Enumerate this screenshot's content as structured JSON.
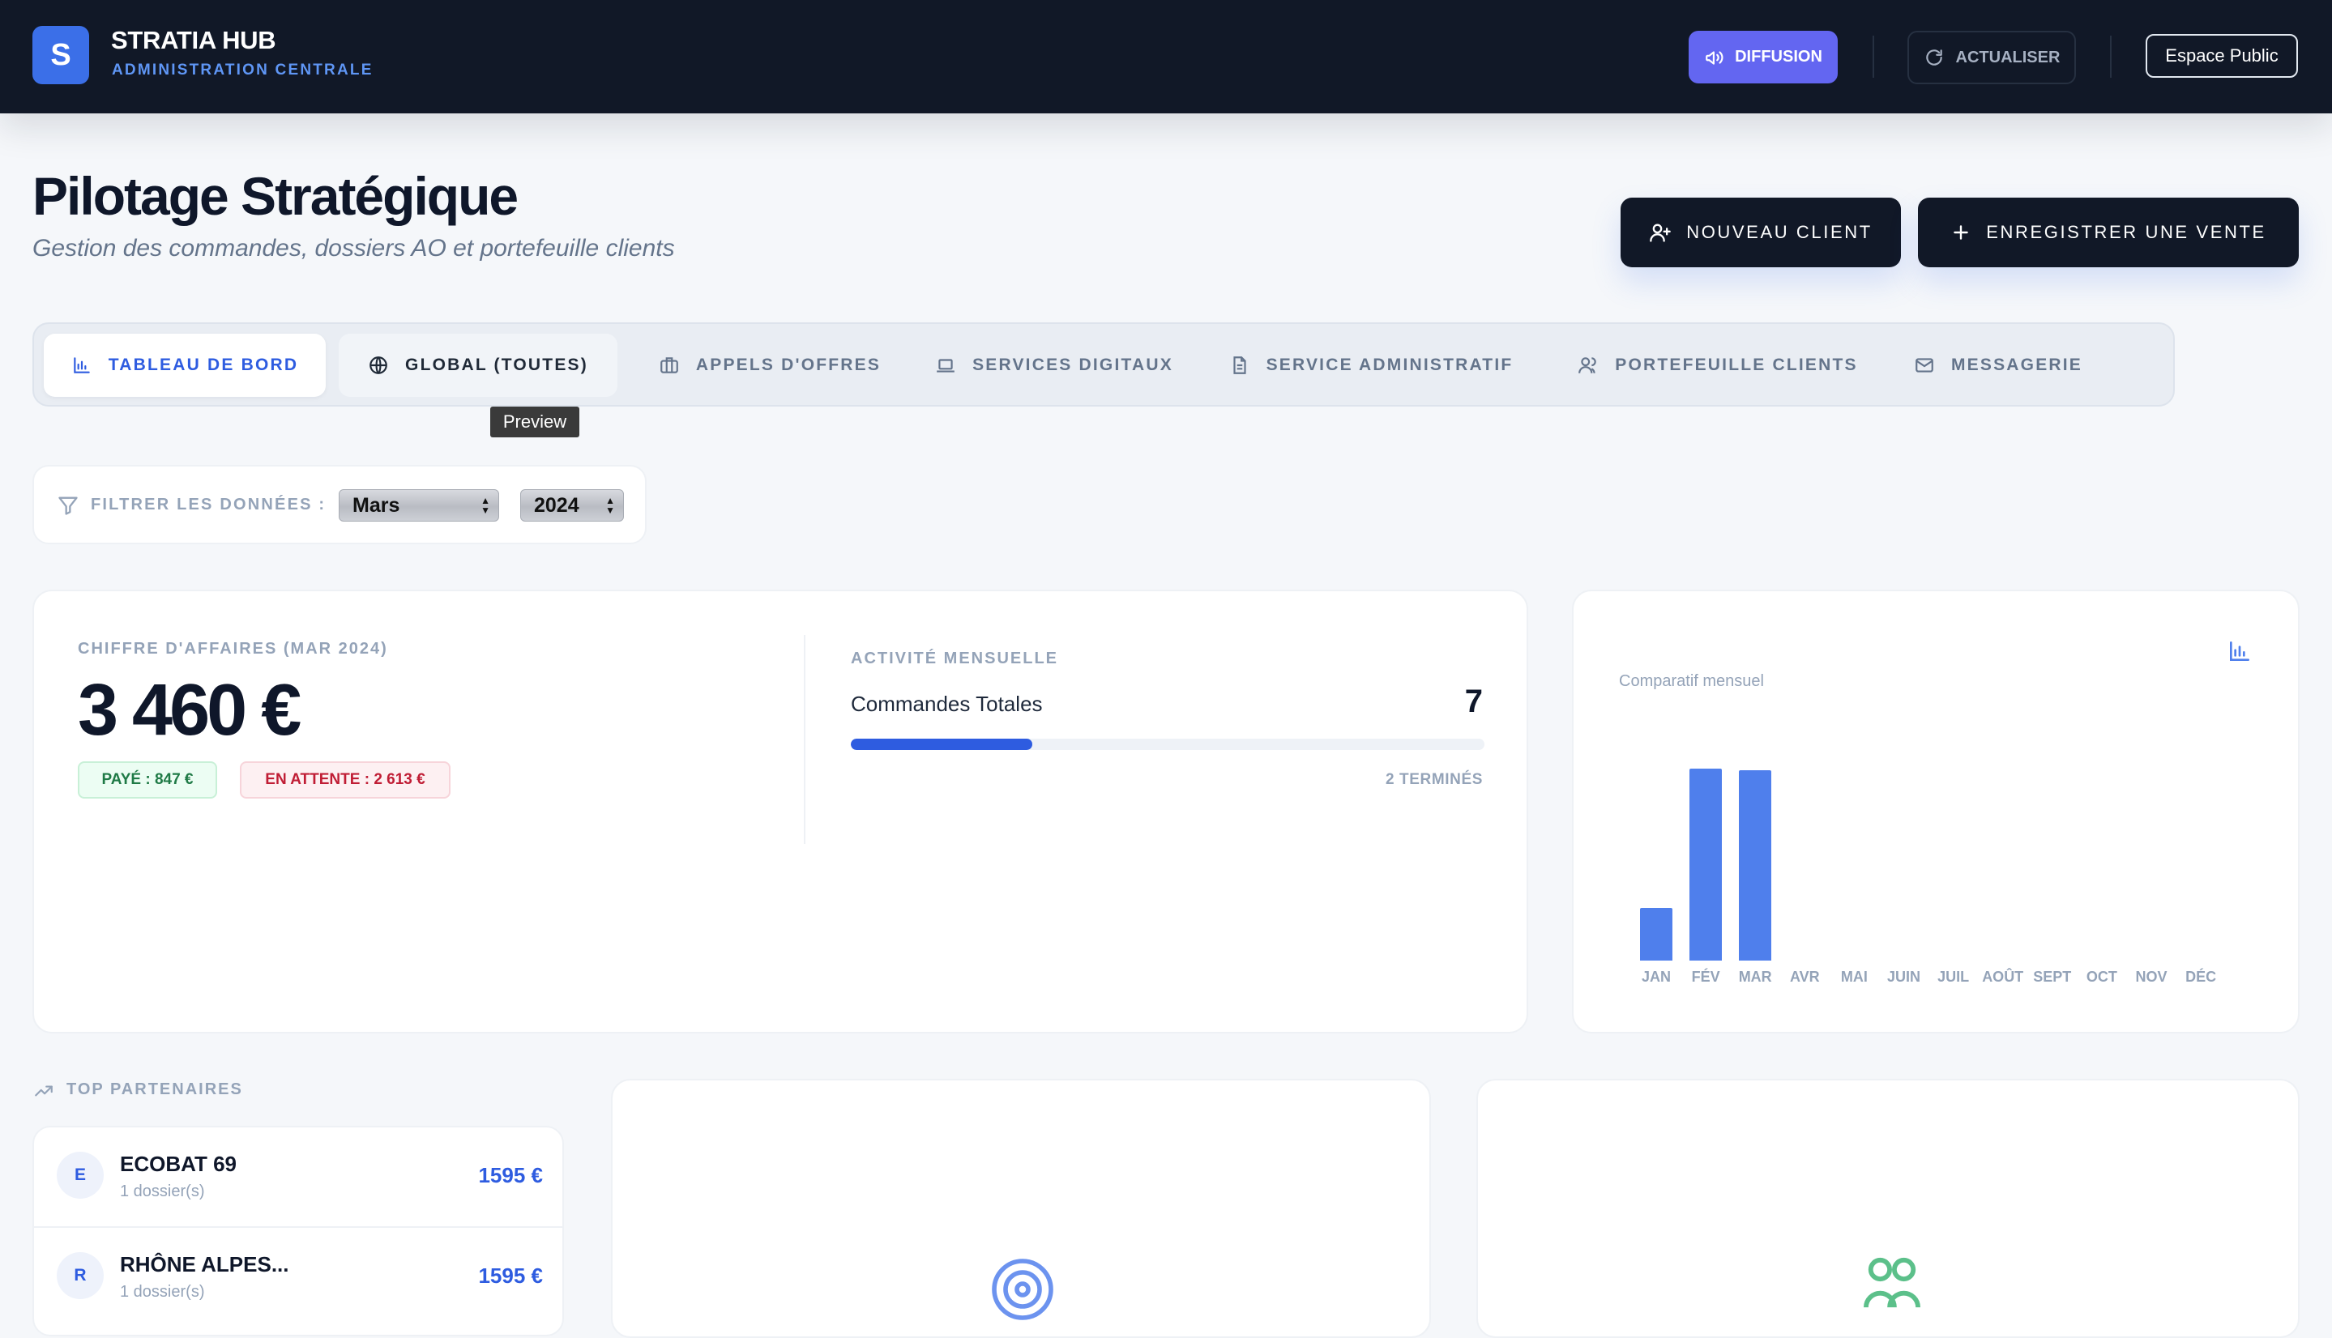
{
  "brand": {
    "logo_letter": "S",
    "title": "STRATIA HUB",
    "subtitle": "ADMINISTRATION CENTRALE"
  },
  "topbar": {
    "diffusion_label": "DIFFUSION",
    "refresh_label": "ACTUALISER",
    "public_label": "Espace Public",
    "accent": "#6366f1",
    "background": "#111827"
  },
  "page": {
    "title": "Pilotage Stratégique",
    "subtitle": "Gestion des commandes, dossiers AO et portefeuille clients",
    "new_client_label": "NOUVEAU CLIENT",
    "new_sale_label": "ENREGISTRER UNE VENTE"
  },
  "tabs": [
    {
      "label": "TABLEAU DE BORD",
      "icon": "bar-chart-icon",
      "active": true
    },
    {
      "label": "GLOBAL (TOUTES)",
      "icon": "globe-icon",
      "active": false
    },
    {
      "label": "APPELS D'OFFRES",
      "icon": "briefcase-icon",
      "active": false
    },
    {
      "label": "SERVICES DIGITAUX",
      "icon": "laptop-icon",
      "active": false
    },
    {
      "label": "SERVICE ADMINISTRATIF",
      "icon": "document-icon",
      "active": false
    },
    {
      "label": "PORTEFEUILLE CLIENTS",
      "icon": "users-icon",
      "active": false
    },
    {
      "label": "MESSAGERIE",
      "icon": "mail-icon",
      "active": false
    }
  ],
  "tooltip": "Preview",
  "filter": {
    "label": "FILTRER LES DONNÉES :",
    "month": "Mars",
    "year": "2024"
  },
  "kpi": {
    "revenue_label": "CHIFFRE D'AFFAIRES (MAR 2024)",
    "revenue_value": "3 460 €",
    "paid": "PAYÉ : 847 €",
    "pending": "EN ATTENTE : 2 613 €",
    "activity_label": "ACTIVITÉ MENSUELLE",
    "orders_label": "Commandes Totales",
    "orders_value": "7",
    "progress_fraction": 0.286,
    "done_label": "2 TERMINÉS"
  },
  "chart_data": {
    "type": "bar",
    "subtitle": "Comparatif mensuel",
    "categories": [
      "JAN",
      "FÉV",
      "MAR",
      "AVR",
      "MAI",
      "JUIN",
      "JUIL",
      "AOÛT",
      "SEPT",
      "OCT",
      "NOV",
      "DÉC"
    ],
    "values": [
      1000,
      3630,
      3600,
      0,
      0,
      0,
      0,
      0,
      0,
      0,
      0,
      0
    ],
    "ylim": [
      0,
      3800
    ],
    "color": "#4f7fec",
    "grid": false,
    "legend": "none"
  },
  "partners": {
    "section_title": "TOP PARTENAIRES",
    "items": [
      {
        "initial": "E",
        "name": "ECOBAT 69",
        "count": "1 dossier(s)",
        "amount": "1595 €"
      },
      {
        "initial": "R",
        "name": "RHÔNE ALPES...",
        "count": "1 dossier(s)",
        "amount": "1595 €"
      }
    ]
  }
}
